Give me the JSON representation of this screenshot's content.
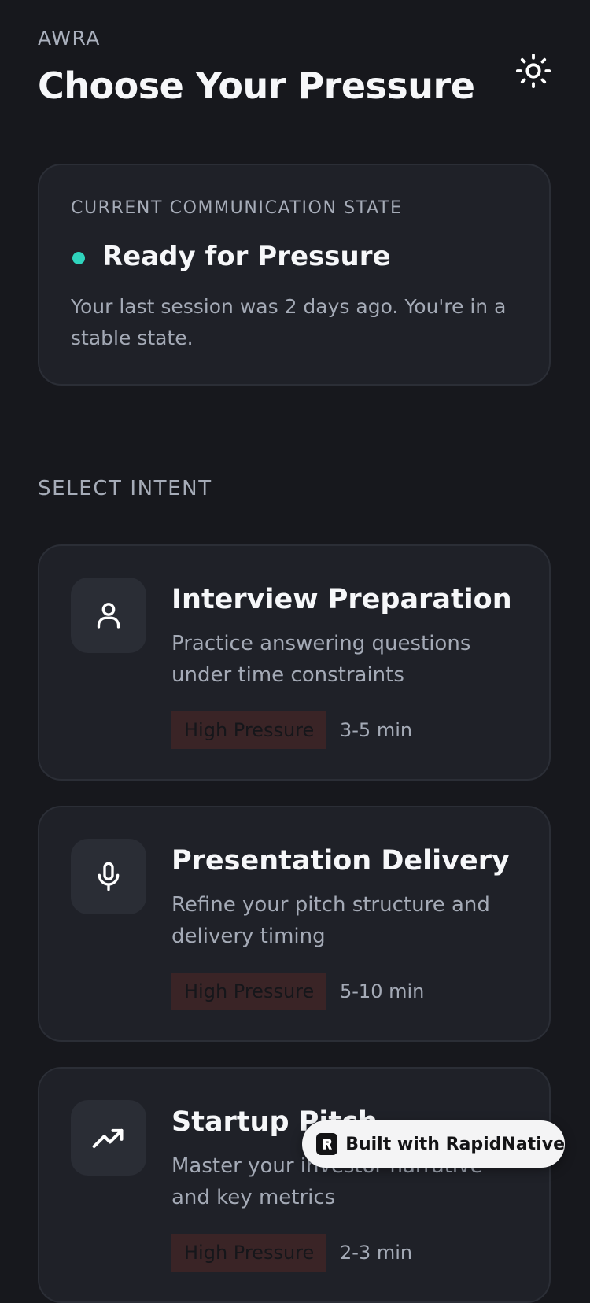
{
  "header": {
    "app_label": "AWRA",
    "title": "Choose Your Pressure",
    "theme_icon": "sun-icon"
  },
  "state_card": {
    "eyebrow": "CURRENT COMMUNICATION STATE",
    "status": "Ready for Pressure",
    "status_color": "#2fd4bd",
    "description": "Your last session was 2 days ago. You're in a stable state."
  },
  "intent_section": {
    "label": "SELECT INTENT",
    "items": [
      {
        "icon": "user-icon",
        "title": "Interview Preparation",
        "description": "Practice answering questions under time constraints",
        "pressure": "High Pressure",
        "duration": "3-5 min"
      },
      {
        "icon": "microphone-icon",
        "title": "Presentation Delivery",
        "description": "Refine your pitch structure and delivery timing",
        "pressure": "High Pressure",
        "duration": "5-10 min"
      },
      {
        "icon": "trending-up-icon",
        "title": "Startup Pitch",
        "description": "Master your investor narrative and key metrics",
        "pressure": "High Pressure",
        "duration": "2-3 min"
      }
    ]
  },
  "built_badge": {
    "label": "Built with RapidNative"
  },
  "colors": {
    "background": "#17181d",
    "card": "#1f2128",
    "accent": "#2fd4bd",
    "badge": "#3a2426"
  }
}
